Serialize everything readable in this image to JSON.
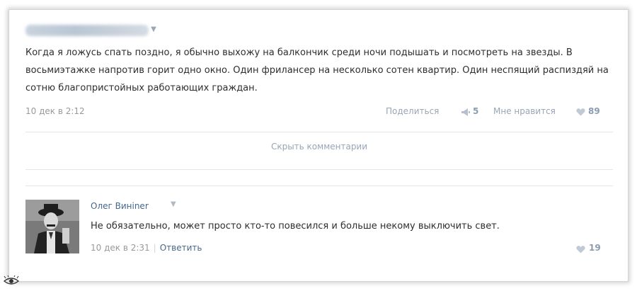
{
  "post": {
    "text": "Когда я ложусь спать поздно, я обычно выхожу на балкончик среди ночи подышать и посмотреть на звезды. В восьмиэтажке напротив горит одно окно. Один фрилансер на несколько сотен квартир. Один неспящий распиздяй на сотню благопристойных работающих граждан.",
    "date": "10 дек в 2:12",
    "share_label": "Поделиться",
    "share_count": "5",
    "like_label": "Мне нравится",
    "like_count": "89",
    "chevron": "▼"
  },
  "hide_comments_label": "Скрыть комментарии",
  "comment": {
    "author": "Олег Винiner",
    "chevron": "▼",
    "text": "Не обязательно, может просто кто-то повесился и больше некому выключить свет.",
    "date": "10 дек в 2:31",
    "separator": "|",
    "reply_label": "Ответить",
    "like_count": "19"
  },
  "colors": {
    "link": "#45678e",
    "meta": "#999999",
    "action": "#98a5b6",
    "text": "#2e2e2e"
  },
  "icons": [
    "share-megaphone-icon",
    "heart-icon",
    "eye-logo-icon"
  ]
}
